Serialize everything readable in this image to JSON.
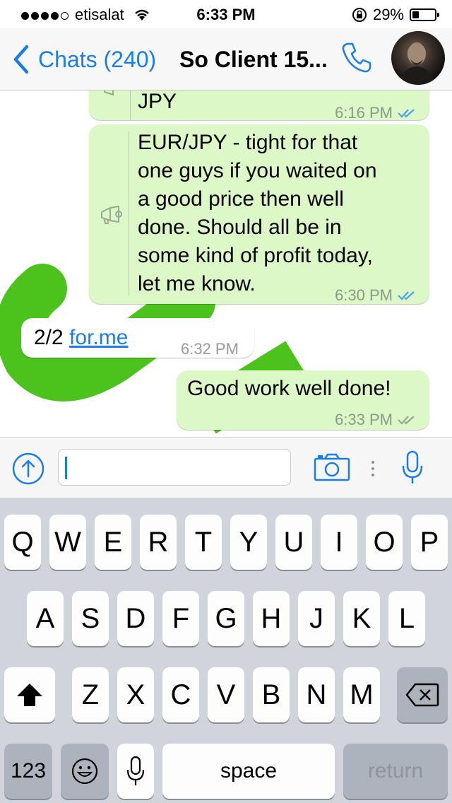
{
  "status_bar": {
    "carrier": "etisalat",
    "time": "6:33 PM",
    "battery": "29%",
    "battery_level": 0.29
  },
  "nav": {
    "back_label": "Chats (240)",
    "title": "So Client 15...",
    "icons": [
      "chevron-left-icon",
      "phone-icon",
      "avatar"
    ]
  },
  "messages": [
    {
      "direction": "out",
      "broadcast": true,
      "text": "JPY",
      "time": "6:16 PM",
      "ticks": "read"
    },
    {
      "direction": "out",
      "broadcast": true,
      "lines": [
        "EUR/JPY - tight for that",
        "one guys if you waited on",
        "a good price then well",
        "done. Should all be in",
        "some kind of profit today,",
        "let me know."
      ],
      "time": "6:30 PM",
      "ticks": "read"
    },
    {
      "direction": "in",
      "text_prefix": "2/2",
      "link": "for.me",
      "time": "6:32 PM"
    },
    {
      "direction": "out",
      "text": "Good work well done!",
      "time": "6:33 PM",
      "ticks": "delivered"
    }
  ],
  "input_bar": {
    "icons": [
      "upload-arrow-icon",
      "camera-icon",
      "mic-icon"
    ],
    "value": ""
  },
  "keyboard": {
    "row1": [
      "Q",
      "W",
      "E",
      "R",
      "T",
      "Y",
      "U",
      "I",
      "O",
      "P"
    ],
    "row2": [
      "A",
      "S",
      "D",
      "F",
      "G",
      "H",
      "J",
      "K",
      "L"
    ],
    "row3": [
      "Z",
      "X",
      "C",
      "V",
      "B",
      "N",
      "M"
    ],
    "num_label": "123",
    "space_label": "space",
    "return_label": "return"
  },
  "colors": {
    "accent": "#1a7ee6",
    "outgoing_bubble": "#dcf8c6",
    "read_ticks": "#4aa3e8",
    "wallpaper_green": "#4cc21c"
  }
}
